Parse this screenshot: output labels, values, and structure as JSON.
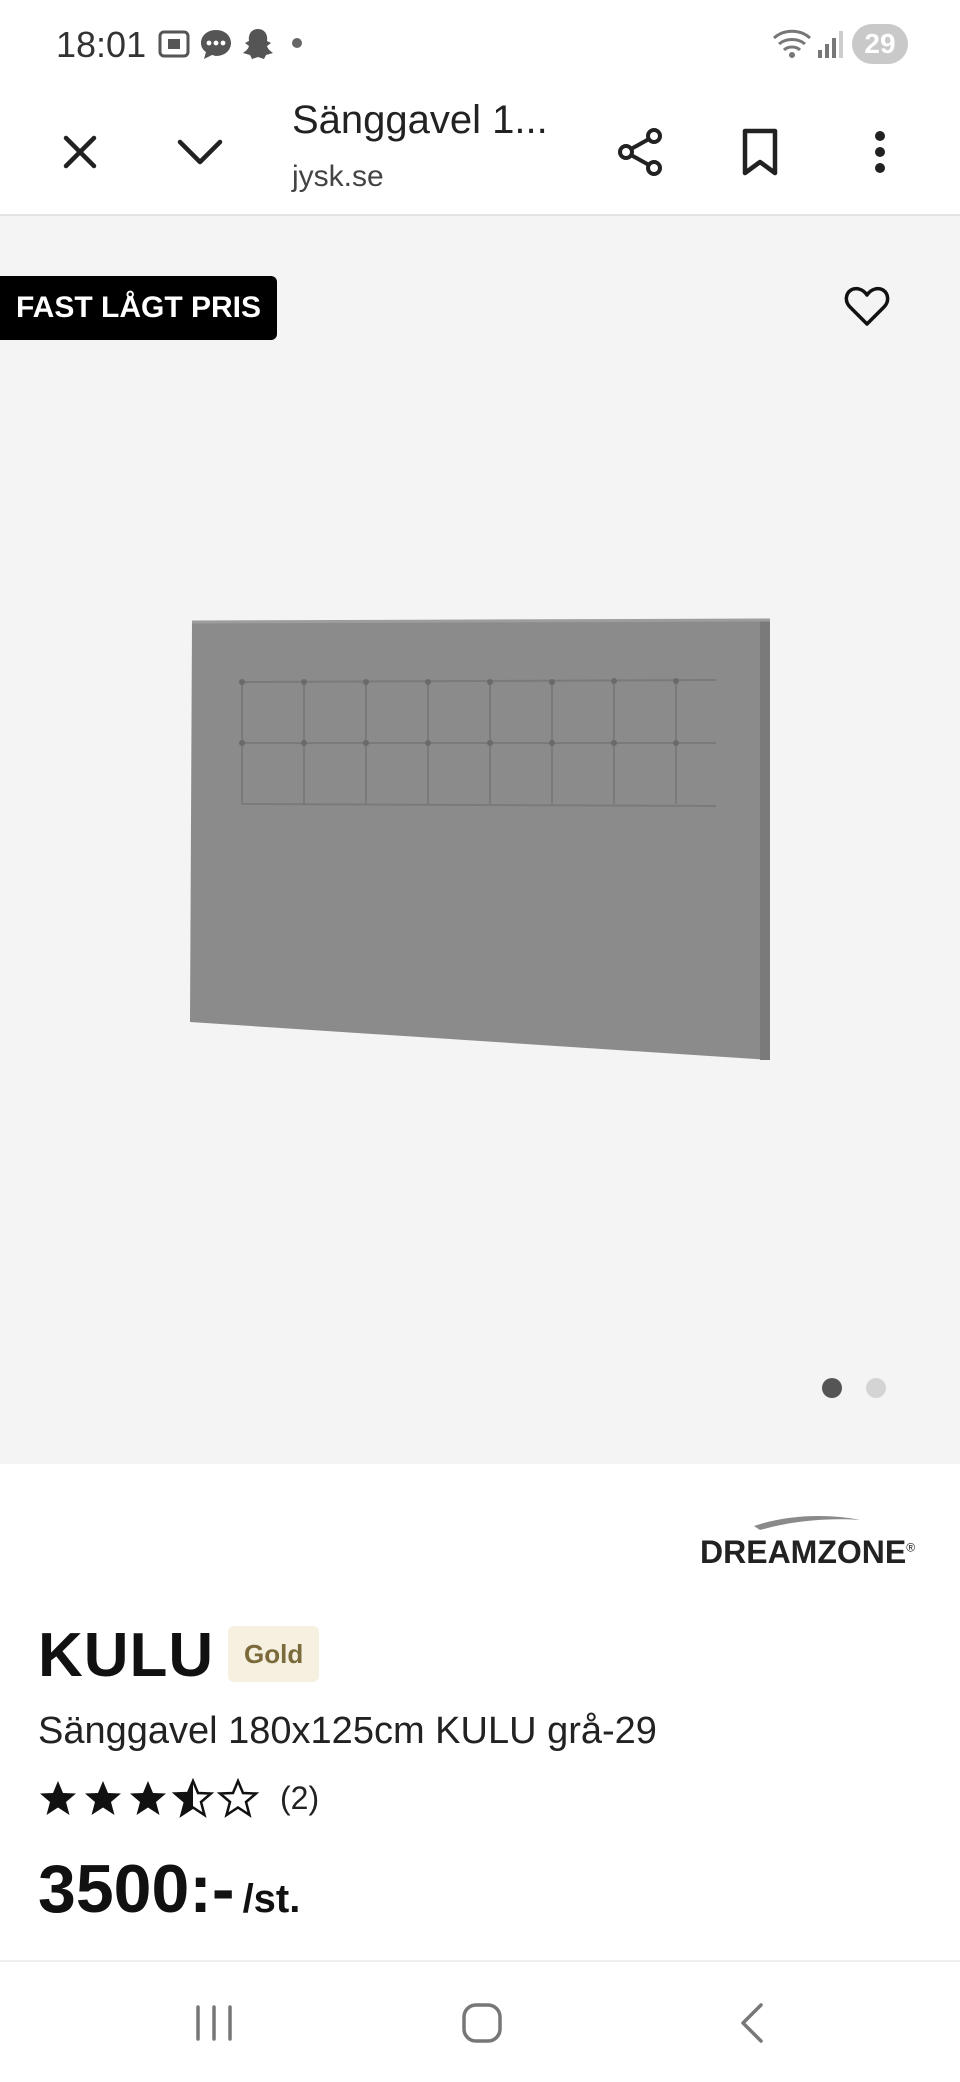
{
  "status_bar": {
    "time": "18:01",
    "battery": "29",
    "icons": [
      "screenshot-icon",
      "chat-icon",
      "snapchat-icon",
      "dot-icon",
      "wifi-icon",
      "signal-icon"
    ]
  },
  "toolbar": {
    "title": "Sänggavel 1...",
    "url": "jysk.se",
    "icons": [
      "close-icon",
      "chevron-down-icon",
      "share-icon",
      "bookmark-icon",
      "more-vert-icon"
    ]
  },
  "gallery": {
    "badge": "FAST LÅGT PRIS",
    "pages": 2,
    "active_page": 1
  },
  "product": {
    "brand": "DREAMZONE",
    "name": "KULU",
    "tier": "Gold",
    "description": "Sänggavel 180x125cm KULU grå-29",
    "rating": 3.5,
    "rating_max": 5,
    "review_count": "(2)",
    "price": "3500:-",
    "unit": "/st."
  },
  "nav_bar": {
    "icons": [
      "recent-apps-icon",
      "home-icon",
      "back-icon"
    ]
  }
}
